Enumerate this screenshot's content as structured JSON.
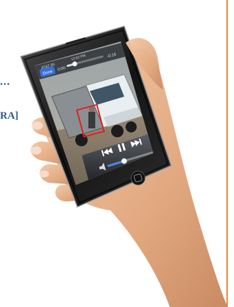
{
  "side": {
    "line1": "...",
    "line2": "RA]"
  },
  "phone": {
    "status": {
      "carrier": "AT&T 3G",
      "time": "12:02 PM"
    },
    "player": {
      "done_label": "Done",
      "elapsed": "0:00",
      "remaining": "-0:16",
      "progress": 0.22,
      "volume": 0.35
    }
  },
  "colors": {
    "accent_rule": "#e8893a",
    "side_text": "#2b5a8c",
    "detection_box": "#e02020"
  },
  "icons": [
    "previous-track-icon",
    "pause-icon",
    "next-track-icon",
    "speaker-icon",
    "home-button-icon"
  ]
}
